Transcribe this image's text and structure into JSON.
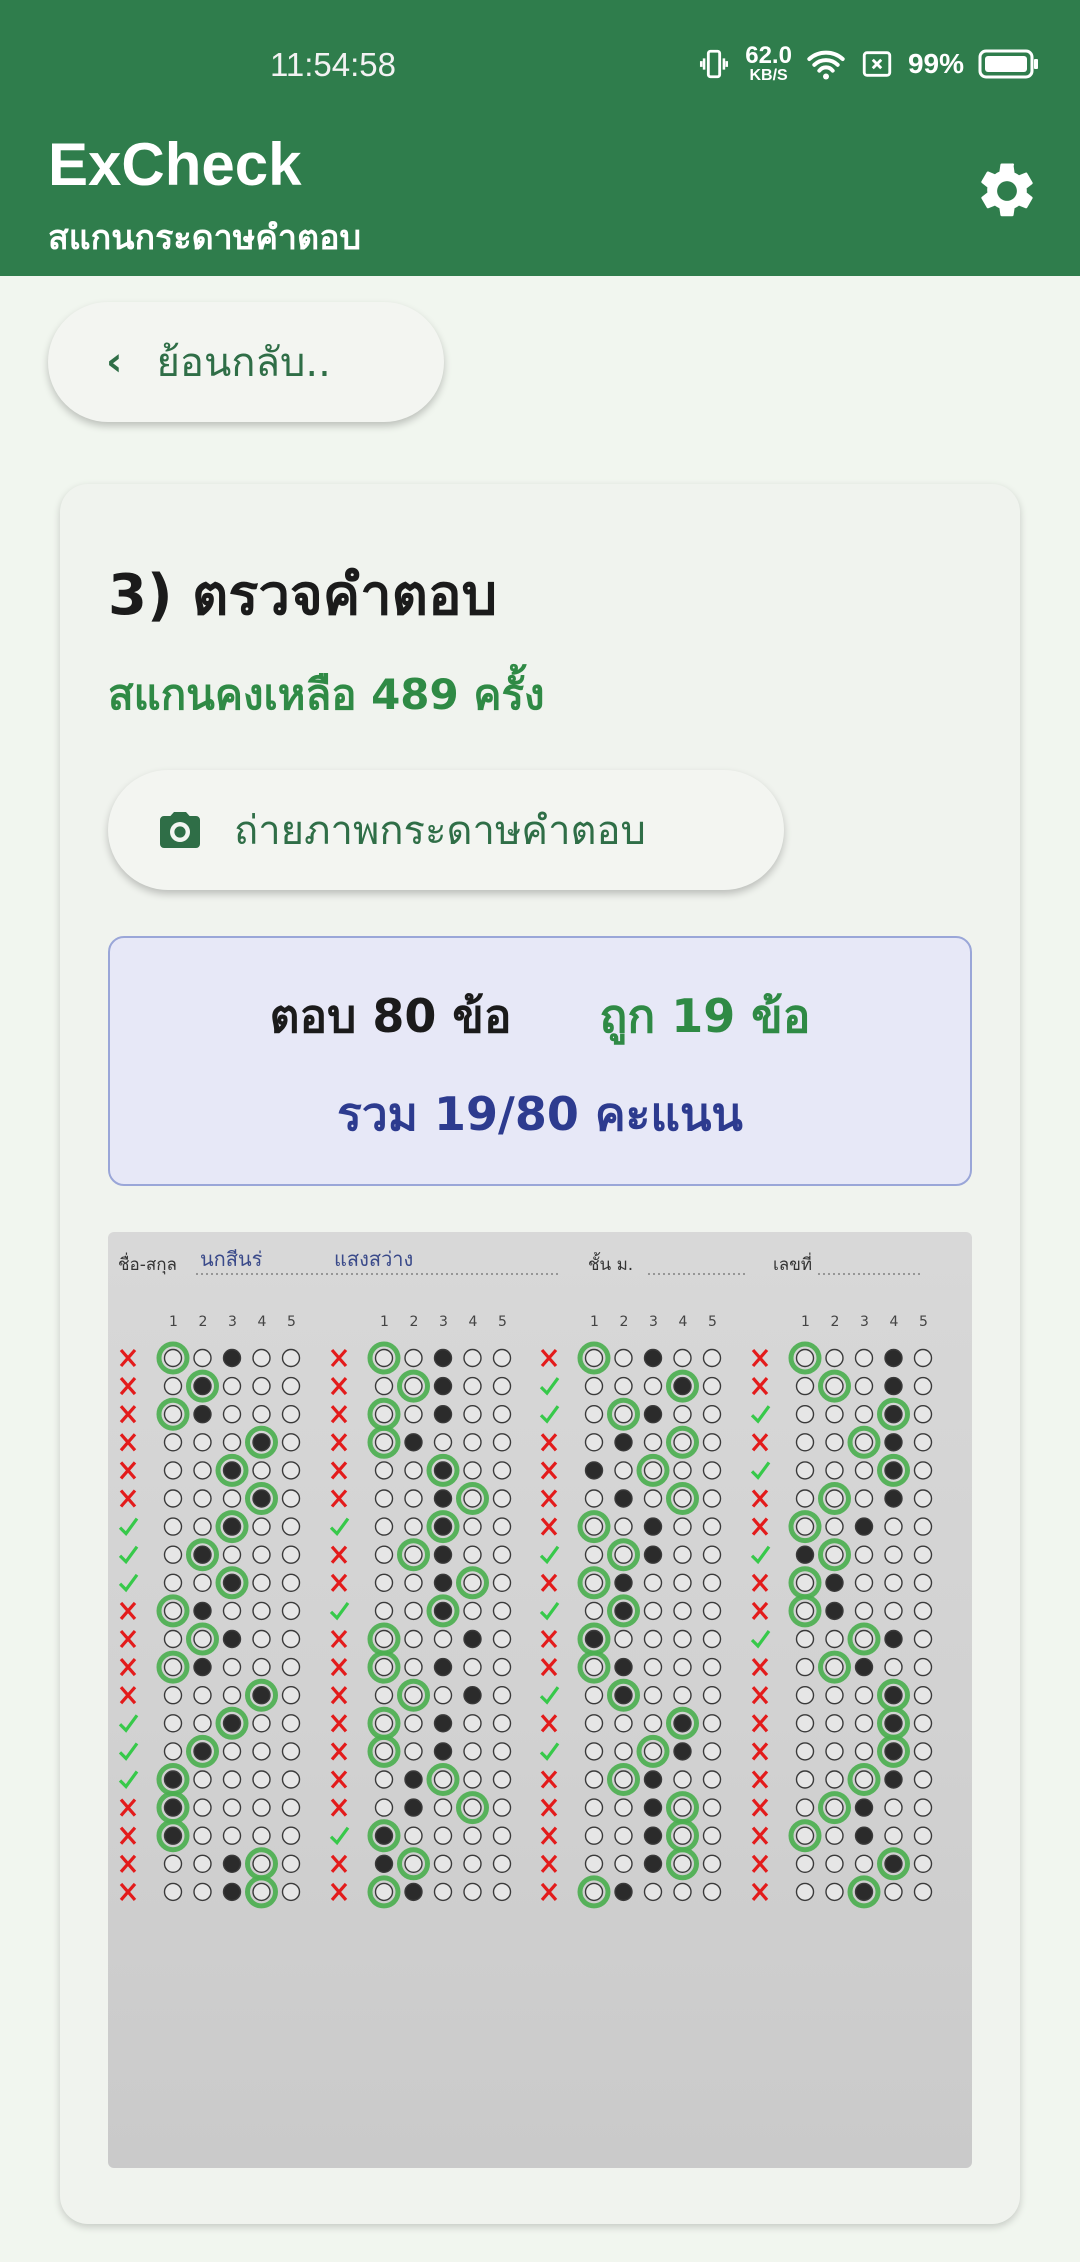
{
  "status_bar": {
    "time": "11:54:58",
    "net_speed": "62.0",
    "net_unit": "KB/S",
    "battery": "99%"
  },
  "app_bar": {
    "title": "ExCheck",
    "subtitle": "สแกนกระดาษคำตอบ"
  },
  "back_button": {
    "label": "ย้อนกลับ.."
  },
  "card": {
    "title": "3) ตรวจคำตอบ",
    "remaining": "สแกนคงเหลือ 489 ครั้ง",
    "photo_button": "ถ่ายภาพกระดาษคำตอบ",
    "summary": {
      "answered": "ตอบ 80 ข้อ",
      "correct": "ถูก 19 ข้อ",
      "total": "รวม 19/80 คะแนน"
    }
  },
  "sheet": {
    "name_label": "ชื่อ-สกุล",
    "name_value": "นกสีนร่",
    "surname_value": "แสงสว่าง",
    "class_label": "ชั้น ม.",
    "number_label": "เลขที่",
    "choice_headers": [
      "1",
      "2",
      "3",
      "4",
      "5"
    ],
    "columns": [
      {
        "filled": [
          3,
          2,
          2,
          4,
          3,
          4,
          3,
          2,
          3,
          2,
          3,
          2,
          4,
          3,
          2,
          1,
          1,
          1,
          3,
          3
        ],
        "chosen": [
          1,
          2,
          1,
          4,
          3,
          4,
          3,
          2,
          3,
          1,
          2,
          1,
          4,
          3,
          2,
          1,
          1,
          1,
          4,
          4
        ],
        "result": "xxxxxxvvvxxxxvvvxxxx"
      },
      {
        "filled": [
          3,
          3,
          3,
          2,
          3,
          3,
          3,
          3,
          3,
          3,
          4,
          3,
          4,
          3,
          3,
          2,
          2,
          1,
          1,
          2
        ],
        "chosen": [
          1,
          2,
          1,
          1,
          3,
          4,
          3,
          2,
          4,
          3,
          1,
          1,
          2,
          1,
          1,
          3,
          4,
          1,
          2,
          1
        ],
        "result": "xxxxxxvxxvxxxxxxxvxx"
      },
      {
        "filled": [
          3,
          4,
          3,
          2,
          1,
          2,
          3,
          3,
          2,
          2,
          1,
          2,
          2,
          4,
          4,
          3,
          3,
          3,
          3,
          2
        ],
        "chosen": [
          1,
          4,
          2,
          4,
          3,
          4,
          1,
          2,
          1,
          2,
          1,
          1,
          2,
          4,
          3,
          2,
          4,
          4,
          4,
          1
        ],
        "result": "xvvxxxxvxvxxvxvxxxxx"
      },
      {
        "filled": [
          4,
          4,
          4,
          4,
          4,
          4,
          3,
          1,
          2,
          2,
          4,
          3,
          4,
          4,
          4,
          4,
          3,
          3,
          4,
          3
        ],
        "chosen": [
          1,
          2,
          4,
          3,
          4,
          2,
          1,
          2,
          1,
          1,
          3,
          2,
          4,
          4,
          4,
          3,
          2,
          1,
          4,
          3
        ],
        "result": "xxvxvxxvxxvxxxxxxxxx"
      }
    ]
  },
  "colors": {
    "primary": "#2f7d4c",
    "correct": "#2f8a45",
    "total": "#2d3b8f",
    "wrong_mark": "#e31b1b",
    "right_mark": "#37c94a",
    "ring": "#4caf50"
  },
  "icons": [
    "vibrate-icon",
    "wifi-icon",
    "sim-off-icon",
    "battery-icon",
    "settings-gear-icon",
    "chevron-left-icon",
    "camera-icon"
  ]
}
